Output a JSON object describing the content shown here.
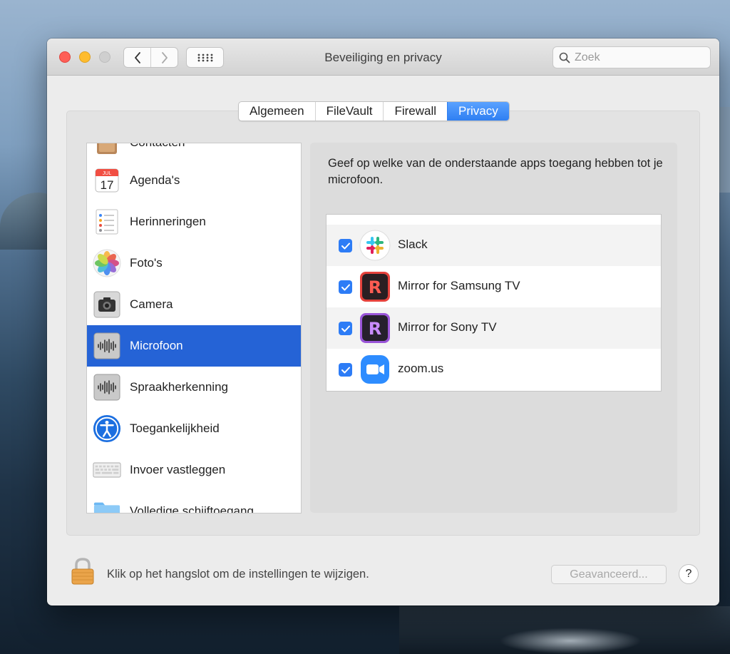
{
  "window": {
    "title": "Beveiliging en privacy"
  },
  "search": {
    "placeholder": "Zoek"
  },
  "tabs": [
    {
      "label": "Algemeen",
      "active": false
    },
    {
      "label": "FileVault",
      "active": false
    },
    {
      "label": "Firewall",
      "active": false
    },
    {
      "label": "Privacy",
      "active": true
    }
  ],
  "sidebar": {
    "items": [
      {
        "label": "Contacten",
        "icon": "contacts-icon",
        "selected": false
      },
      {
        "label": "Agenda's",
        "icon": "calendar-icon",
        "selected": false,
        "calendar_month": "JUL",
        "calendar_day": "17"
      },
      {
        "label": "Herinneringen",
        "icon": "reminders-icon",
        "selected": false
      },
      {
        "label": "Foto's",
        "icon": "photos-icon",
        "selected": false
      },
      {
        "label": "Camera",
        "icon": "camera-icon",
        "selected": false
      },
      {
        "label": "Microfoon",
        "icon": "microphone-icon",
        "selected": true
      },
      {
        "label": "Spraakherkenning",
        "icon": "speech-recognition-icon",
        "selected": false
      },
      {
        "label": "Toegankelijkheid",
        "icon": "accessibility-icon",
        "selected": false
      },
      {
        "label": "Invoer vastleggen",
        "icon": "keyboard-icon",
        "selected": false
      },
      {
        "label": "Volledige schijftoegang",
        "icon": "folder-icon",
        "selected": false
      }
    ]
  },
  "main": {
    "description": "Geef op welke van de onderstaande apps toegang hebben tot je microfoon.",
    "apps": [
      {
        "name": "Slack",
        "checked": true,
        "icon": "slack-icon"
      },
      {
        "name": "Mirror for Samsung TV",
        "checked": true,
        "icon": "mirror-samsung-icon",
        "icon_text": "R"
      },
      {
        "name": "Mirror for Sony TV",
        "checked": true,
        "icon": "mirror-sony-icon",
        "icon_text": "R"
      },
      {
        "name": "zoom.us",
        "checked": true,
        "icon": "zoom-icon"
      }
    ]
  },
  "footer": {
    "lock_text": "Klik op het hangslot om de instellingen te wijzigen.",
    "advanced_label": "Geavanceerd...",
    "help_label": "?"
  },
  "colors": {
    "accent": "#2f7ff2",
    "selection": "#2563d6",
    "checkbox": "#2d7cf6"
  }
}
